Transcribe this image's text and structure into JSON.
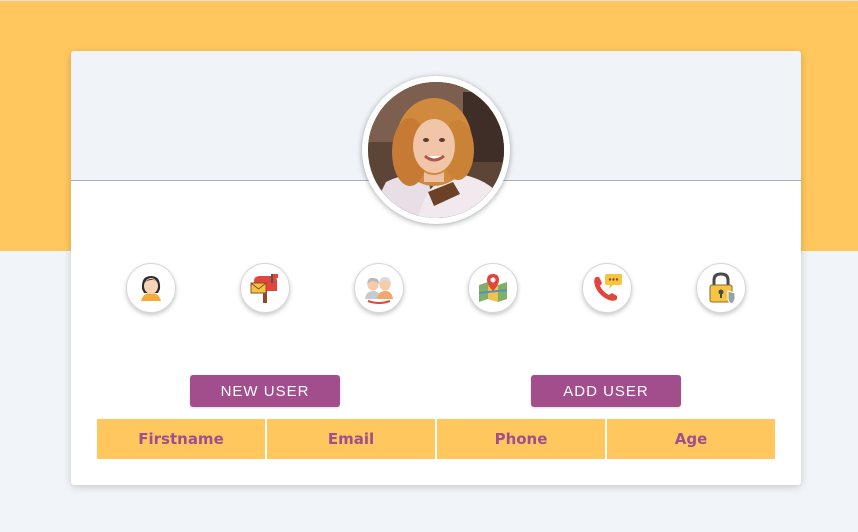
{
  "colors": {
    "banner": "#ffc75d",
    "page_background": "#f1f4f8",
    "accent": "#a24e8d",
    "card": "#ffffff"
  },
  "profile": {
    "avatar_icon": "profile-photo"
  },
  "icon_buttons": [
    {
      "icon": "user-avatar-icon"
    },
    {
      "icon": "mailbox-icon"
    },
    {
      "icon": "elderly-couple-icon"
    },
    {
      "icon": "map-location-icon"
    },
    {
      "icon": "phone-chat-icon"
    },
    {
      "icon": "padlock-shield-icon"
    }
  ],
  "actions": {
    "new_user_label": "NEW USER",
    "add_user_label": "ADD USER"
  },
  "table": {
    "columns": [
      "Firstname",
      "Email",
      "Phone",
      "Age"
    ]
  }
}
